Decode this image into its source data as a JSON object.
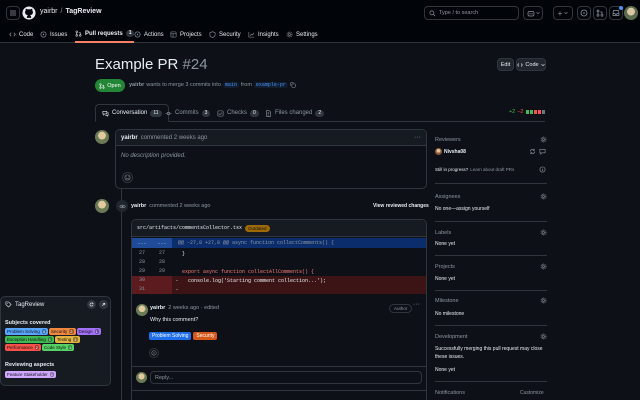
{
  "header": {
    "owner": "yairbr",
    "separator": "/",
    "repo": "TagReview",
    "search_placeholder": "Type / to search",
    "plus_label": "+"
  },
  "repo_nav": {
    "items": [
      {
        "label": "Code"
      },
      {
        "label": "Issues"
      },
      {
        "label": "Pull requests",
        "count": "1"
      },
      {
        "label": "Actions"
      },
      {
        "label": "Projects"
      },
      {
        "label": "Security"
      },
      {
        "label": "Insights"
      },
      {
        "label": "Settings"
      }
    ]
  },
  "pr": {
    "title": "Example PR",
    "number": "#24",
    "edit_label": "Edit",
    "code_label": "Code",
    "state": "Open",
    "author": "yairbr",
    "summary_text": "wants to merge 3 commits into",
    "base_branch": "main",
    "from_text": "from",
    "head_branch": "example-pr",
    "diffstat_add": "+2",
    "diffstat_del": "−2",
    "diffstat_colors": [
      "#3fb950",
      "#3fb950",
      "#f85149",
      "#f85149",
      "#6e7681"
    ]
  },
  "tabs": [
    {
      "label": "Conversation",
      "count": "11"
    },
    {
      "label": "Commits",
      "count": "3"
    },
    {
      "label": "Checks",
      "count": "0"
    },
    {
      "label": "Files changed",
      "count": "2"
    }
  ],
  "comment1": {
    "author": "yairbr",
    "meta": "commented 2 weeks ago",
    "body": "No description provided.",
    "menu": "···"
  },
  "review": {
    "author": "yairbr",
    "meta": "commented 2 weeks ago",
    "view_changes": "View reviewed changes",
    "file_path": "src/artifacts/commentsCollector.tsx",
    "outdated_label": "Outdated",
    "hunk_dots": "...",
    "hunk_header": "@@ -27,8 +27,8 @@ async function collectComments() {",
    "lines": [
      {
        "old": "27",
        "new": "27",
        "sign": "",
        "code": "}",
        "kind": "ctx"
      },
      {
        "old": "28",
        "new": "28",
        "sign": "",
        "code": "",
        "kind": "ctx"
      },
      {
        "old": "29",
        "new": "29",
        "sign": "",
        "code": "export async function collectAllComments() {",
        "kind": "ctx"
      },
      {
        "old": "30",
        "new": "",
        "sign": "-",
        "code": "  console.log('Starting comment collection...');",
        "kind": "del"
      },
      {
        "old": "31",
        "new": "",
        "sign": "-",
        "code": "",
        "kind": "del"
      }
    ],
    "reply": {
      "author": "yairbr",
      "meta": "2 weeks ago · edited",
      "menu": "···",
      "role_badge": "Author",
      "body": "Why this comment?",
      "tags": [
        {
          "label": "Problem Solving",
          "color": "#1f6feb"
        },
        {
          "label": "Security",
          "color": "#d4581a"
        }
      ]
    },
    "reply_placeholder": "Reply..."
  },
  "sidebar": {
    "reviewers": {
      "heading": "Reviewers",
      "user": "Nivsha08",
      "draft_text": "Still in progress?",
      "draft_link": "Learn about draft PRs"
    },
    "assignees": {
      "heading": "Assignees",
      "value": "No one—",
      "link": "assign yourself"
    },
    "labels": {
      "heading": "Labels",
      "value": "None yet"
    },
    "projects": {
      "heading": "Projects",
      "value": "None yet"
    },
    "milestone": {
      "heading": "Milestone",
      "value": "No milestone"
    },
    "development": {
      "heading": "Development",
      "text": "Successfully merging this pull request may close these issues.",
      "value": "None yet"
    },
    "notifications": {
      "heading": "Notifications",
      "customize": "Customize"
    }
  },
  "tag_panel": {
    "title": "TagReview",
    "subjects_heading": "Subjects covered",
    "subjects": [
      {
        "label": "Problem Solving",
        "count": "4",
        "color": "#58a6ff"
      },
      {
        "label": "Security",
        "count": "2",
        "color": "#f0883e"
      },
      {
        "label": "Design",
        "count": "1",
        "color": "#a371f7"
      },
      {
        "label": "Exception Handling",
        "count": "1",
        "color": "#3fb950"
      },
      {
        "label": "Testing",
        "count": "1",
        "color": "#e3b341"
      },
      {
        "label": "Performance",
        "count": "2",
        "color": "#f85149"
      },
      {
        "label": "Code Style",
        "count": "1",
        "color": "#56d364"
      }
    ],
    "aspects_heading": "Reviewing aspects",
    "aspects": [
      {
        "label": "Feature Stakeholder",
        "count": "1",
        "color": "#d2a8ff"
      }
    ]
  }
}
